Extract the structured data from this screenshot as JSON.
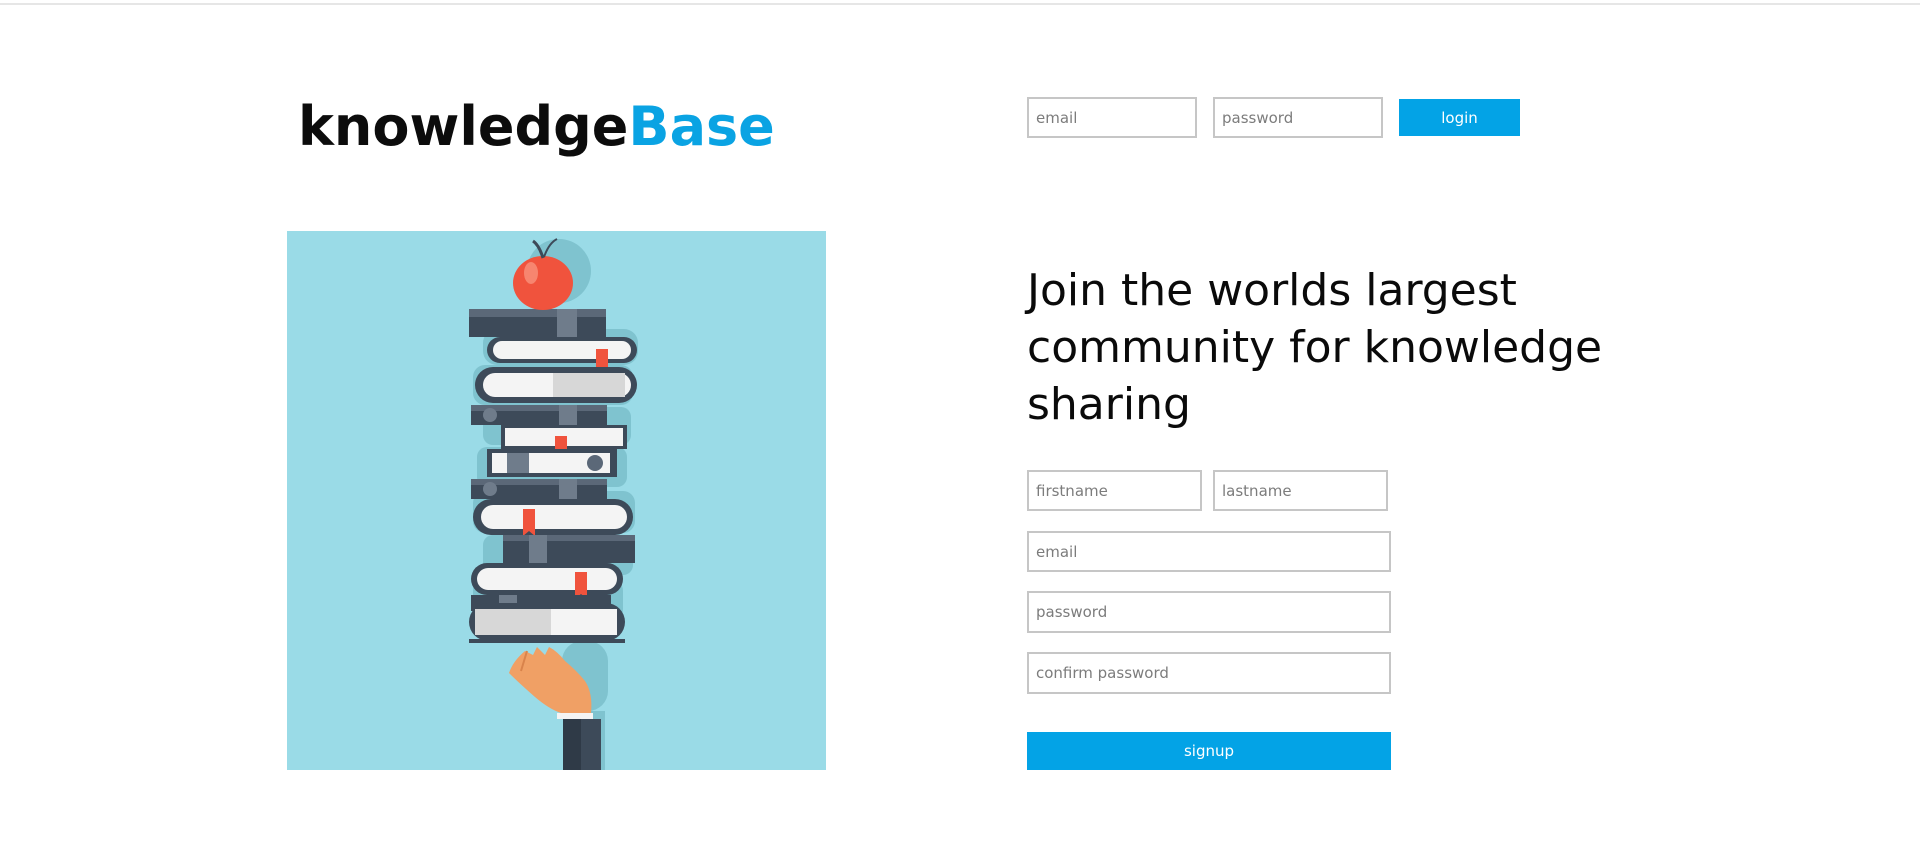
{
  "logo": {
    "part1": "knowledge",
    "part2": "Base"
  },
  "login": {
    "email_placeholder": "email",
    "password_placeholder": "password",
    "button_label": "login"
  },
  "hero": {
    "icon": "stack-of-books-with-apple-illustration"
  },
  "signup": {
    "headline": "Join the worlds largest community for knowledge sharing",
    "firstname_placeholder": "firstname",
    "lastname_placeholder": "lastname",
    "email_placeholder": "email",
    "password_placeholder": "password",
    "confirm_password_placeholder": "confirm password",
    "button_label": "signup"
  },
  "colors": {
    "accent": "#03a3e6",
    "logo_accent": "#0aa3e3",
    "hero_background": "#9adbe7",
    "input_border": "#c6c6c6"
  }
}
